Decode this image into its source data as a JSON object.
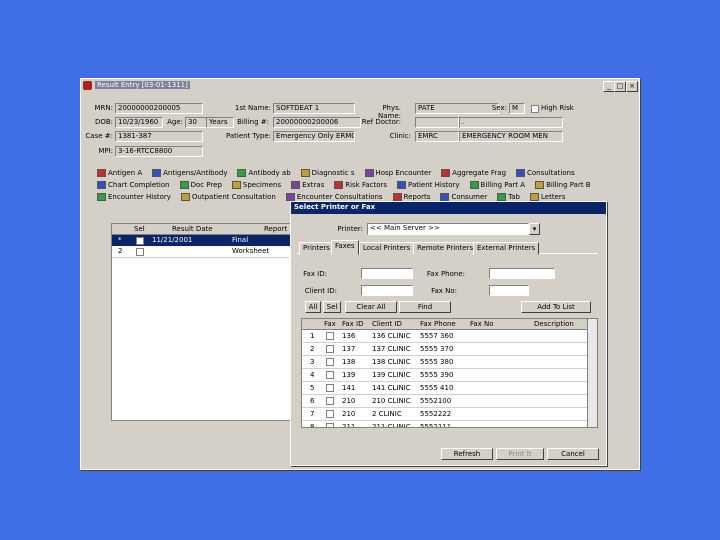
{
  "window": {
    "title": "Result Entry   [03-01-1311]",
    "controls": [
      "_",
      "□",
      "×"
    ]
  },
  "patient": {
    "mrn_label": "MRN:",
    "mrn": "20000000200005",
    "dob_label": "DOB:",
    "dob": "10/23/1960",
    "age_label": "Age:",
    "age": "30",
    "age_unit": "Years",
    "case_label": "Case #:",
    "case": "1381-387",
    "mpi_label": "MPI:",
    "mpi": "3-16-RTCC8800",
    "firstname_label": "1st Name:",
    "firstname": "SOFTDEAT 1",
    "billing_label": "Billing #:",
    "billing": "20000000200006",
    "ptype_label": "Patient Type:",
    "ptype": "Emergency Only ERMC",
    "phys_label": "Phys. Name:",
    "phys": "PATE",
    "sex_label": "Sex:",
    "sex": "M",
    "highrisk_label": "High Risk",
    "refdoc_label": "Ref Doctor:",
    "refdoc": "",
    "refdoc2": ".",
    "clinic_label": "Clinic:",
    "clinic": "EMRC",
    "clinic_desc": "EMERGENCY ROOM MEN"
  },
  "toolbar": {
    "row1": [
      "Antigen A",
      "Antigens/Antibody",
      "Antibody ab",
      "Diagnostic s",
      "Hosp Encounter",
      "Aggregate Frag",
      "Consultations"
    ],
    "row2": [
      "Chart Completion",
      "Doc Prep",
      "Specimens",
      "Extras",
      "Risk Factors",
      "Patient History",
      "Billing Part A",
      "Billing Part B"
    ],
    "row3": [
      "Encounter History",
      "Outpatient Consultation",
      "Encounter Consultations",
      "Reports",
      "Consumer",
      "Tab",
      "Letters"
    ]
  },
  "results_grid": {
    "headers": [
      "Sel",
      "Result Date",
      "Report"
    ],
    "rows": [
      {
        "num": "1",
        "date": "11/21/2001",
        "report": "Final"
      },
      {
        "num": "2",
        "date": "",
        "report": "Worksheet"
      }
    ]
  },
  "dialog": {
    "title": "Select Printer or Fax",
    "printer_label": "Printer:",
    "printer_value": "<< Main Server >>",
    "tabs": [
      "Printers",
      "Faxes",
      "Local Printers",
      "Remote Printers",
      "External Printers"
    ],
    "active_tab": "Faxes",
    "faxid_label": "Fax ID:",
    "faxid": "",
    "faxphone_label": "Fax Phone:",
    "faxphone": "",
    "clientid_label": "Client ID:",
    "clientid": "",
    "faxno_label": "Fax No:",
    "faxno": "",
    "buttons": {
      "all": "All",
      "sel": "Sel",
      "clear_all": "Clear All",
      "find": "Find",
      "add_to_list": "Add To List"
    },
    "grid_headers": [
      "Fax",
      "Fax ID",
      "Client ID",
      "Fax Phone",
      "Fax No",
      "Description"
    ],
    "grid_rows": [
      {
        "num": "1",
        "faxid": "136",
        "client": "136 CLINIC",
        "phone": "5557 360"
      },
      {
        "num": "2",
        "faxid": "137",
        "client": "137 CLINIC",
        "phone": "5555 370"
      },
      {
        "num": "3",
        "faxid": "138",
        "client": "138 CLINIC",
        "phone": "5555 380"
      },
      {
        "num": "4",
        "faxid": "139",
        "client": "139 CLINIC",
        "phone": "5555 390"
      },
      {
        "num": "5",
        "faxid": "141",
        "client": "141 CLINIC",
        "phone": "5555 410"
      },
      {
        "num": "6",
        "faxid": "210",
        "client": "210 CLINIC",
        "phone": "5552100"
      },
      {
        "num": "7",
        "faxid": "210",
        "client": "2 CLINIC",
        "phone": "5552222"
      },
      {
        "num": "8",
        "faxid": "211",
        "client": "211 CLINIC",
        "phone": "5552111"
      }
    ],
    "footer_buttons": {
      "refresh": "Refresh",
      "ok": "Print It",
      "cancel": "Cancel"
    }
  },
  "colors": {
    "desktop": "#3f6ee6",
    "window": "#d4d0c8",
    "selection": "#0a246a"
  }
}
